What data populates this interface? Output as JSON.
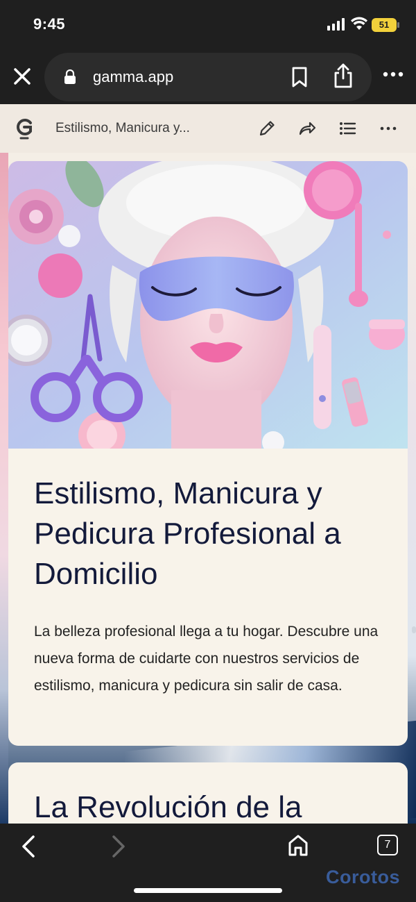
{
  "status_bar": {
    "time": "9:45",
    "battery": "51"
  },
  "browser": {
    "url": "gamma.app",
    "tab_count": "7"
  },
  "gamma_toolbar": {
    "doc_title": "Estilismo, Manicura y..."
  },
  "card_1": {
    "heading": "Estilismo, Manicura y Pedicura Profesional a Domicilio",
    "paragraph": "La belleza profesional llega a tu hogar. Descubre una nueva forma de cuidarte con nuestros servicios de estilismo, manicura y pedicura sin salir de casa."
  },
  "card_2": {
    "heading": "La Revolución de la"
  },
  "watermark": "Corotos",
  "colors": {
    "chrome_dark": "#1f1f1f",
    "toolbar_bg": "#f0e9e1",
    "card_bg": "#f8f3ea",
    "heading_color": "#131a3b",
    "battery_yellow": "#f2d13b"
  }
}
